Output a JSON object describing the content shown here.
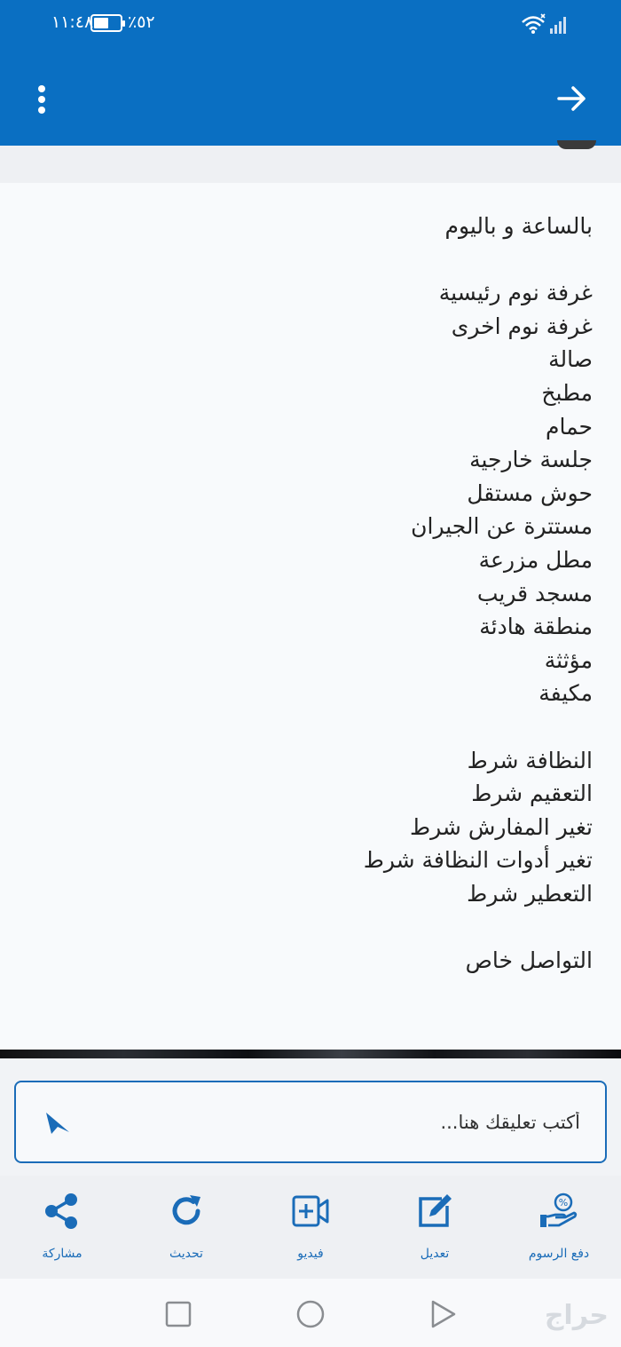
{
  "status_bar": {
    "time": "١١:٤٨",
    "battery_percent": "٪٥٢"
  },
  "post": {
    "lines": [
      "بالساعة و باليوم",
      "",
      "غرفة نوم رئيسية",
      "غرفة نوم اخرى",
      "صالة",
      "مطبخ",
      "حمام",
      "جلسة خارجية",
      "حوش مستقل",
      "مستترة عن الجيران",
      "مطل مزرعة",
      "مسجد قريب",
      "منطقة هادئة",
      "مؤثثة",
      "مكيفة",
      "",
      "النظافة شرط",
      "التعقيم شرط",
      "تغير المفارش شرط",
      "تغير أدوات النظافة شرط",
      "التعطير شرط",
      "",
      "التواصل خاص"
    ]
  },
  "comment": {
    "placeholder": "أكتب تعليقك هنا..."
  },
  "actions": {
    "share": "مشاركة",
    "refresh": "تحديث",
    "video": "فيديو",
    "edit": "تعديل",
    "pay_fees": "دفع الرسوم"
  },
  "watermark": "حراج",
  "colors": {
    "brand_blue": "#0a6fc2",
    "accent_blue": "#1a6cb8"
  }
}
